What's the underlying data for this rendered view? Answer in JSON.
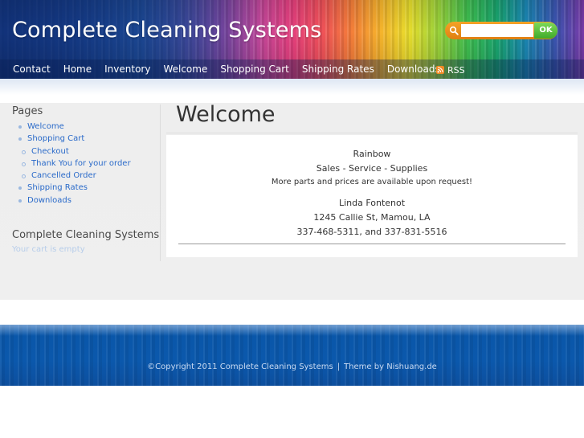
{
  "site": {
    "title": "Complete Cleaning Systems"
  },
  "search": {
    "placeholder": "",
    "button_label": "OK",
    "icon": "search-icon"
  },
  "nav": {
    "items": [
      "Contact",
      "Home",
      "Inventory",
      "Welcome",
      "Shopping Cart",
      "Shipping Rates",
      "Downloads"
    ],
    "rss_label": "RSS",
    "rss_icon": "rss-icon"
  },
  "sidebar": {
    "pages_heading": "Pages",
    "pages": [
      {
        "label": "Welcome",
        "level": 0
      },
      {
        "label": "Shopping Cart",
        "level": 0
      },
      {
        "label": "Checkout",
        "level": 1
      },
      {
        "label": "Thank You for your order",
        "level": 1
      },
      {
        "label": "Cancelled Order",
        "level": 1
      },
      {
        "label": "Shipping Rates",
        "level": 0
      },
      {
        "label": "Downloads",
        "level": 0
      }
    ],
    "cart_heading": "Complete Cleaning Systems",
    "cart_status": "Your cart is empty"
  },
  "main": {
    "title": "Welcome",
    "lines": [
      "Rainbow",
      "Sales - Service - Supplies",
      "More parts and prices are available upon request!",
      "Linda Fontenot",
      "1245 Callie St, Mamou, LA",
      "337-468-5311, and 337-831-5516"
    ]
  },
  "footer": {
    "copyright": "©Copyright 2011 Complete Cleaning Systems",
    "separator": "|",
    "theme_credit": "Theme by Nishuang.de"
  },
  "colors": {
    "link": "#2a6ac9",
    "footer_blue": "#0a56a8",
    "search_orange": "#e07f12",
    "ok_green": "#3faa2a"
  }
}
